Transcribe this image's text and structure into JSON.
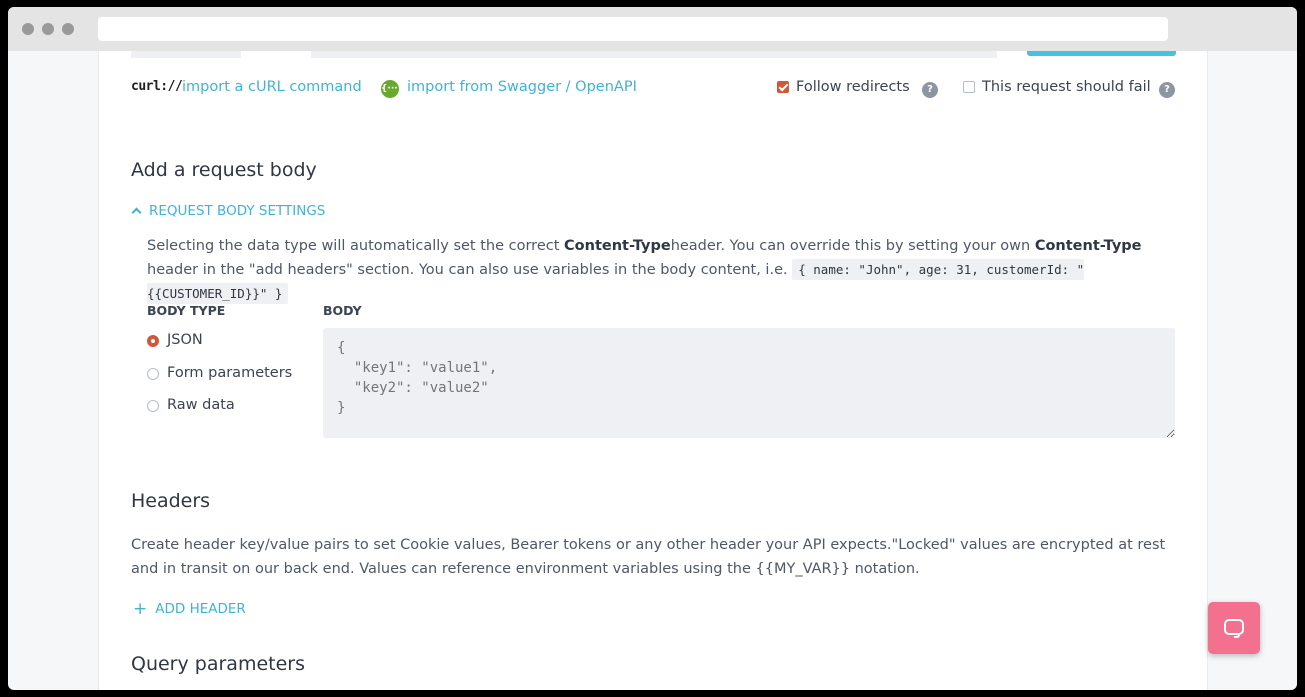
{
  "import": {
    "curl_logo": "curl://",
    "curl_link": "import a cURL command",
    "swagger_icon": "{···}",
    "swagger_link": "import from Swagger / OpenAPI",
    "follow_redirects_label": "Follow redirects",
    "follow_redirects_checked": true,
    "should_fail_label": "This request should fail",
    "should_fail_checked": false,
    "help_glyph": "?"
  },
  "request_body": {
    "title": "Add a request body",
    "settings_toggle": "REQUEST BODY SETTINGS",
    "desc_1": "Selecting the data type will automatically set the correct ",
    "desc_bold_1": "Content-Type",
    "desc_2": "header. You can override this by setting your own ",
    "desc_bold_2": "Content-Type",
    "desc_3": " header in the \"add headers\" section. You can also use variables in the body content, i.e. ",
    "desc_code": "{ name: \"John\", age: 31, customerId: \"{{CUSTOMER_ID}}\" }",
    "body_type_label": "BODY TYPE",
    "body_label": "BODY",
    "body_types": [
      {
        "label": "JSON",
        "selected": true
      },
      {
        "label": "Form parameters",
        "selected": false
      },
      {
        "label": "Raw data",
        "selected": false
      }
    ],
    "body_placeholder": "{\n  \"key1\": \"value1\",\n  \"key2\": \"value2\"\n}"
  },
  "headers": {
    "title": "Headers",
    "description": "Create header key/value pairs to set Cookie values, Bearer tokens or any other header your API expects.\"Locked\" values are encrypted at rest and in transit on our back end. Values can reference environment variables using the {{MY_VAR}} notation.",
    "add_header": "ADD HEADER",
    "add_icon": "+"
  },
  "query": {
    "title": "Query parameters"
  },
  "colors": {
    "accent": "#3fb3d6",
    "checked": "#d0583a",
    "chat": "#f4708f"
  }
}
